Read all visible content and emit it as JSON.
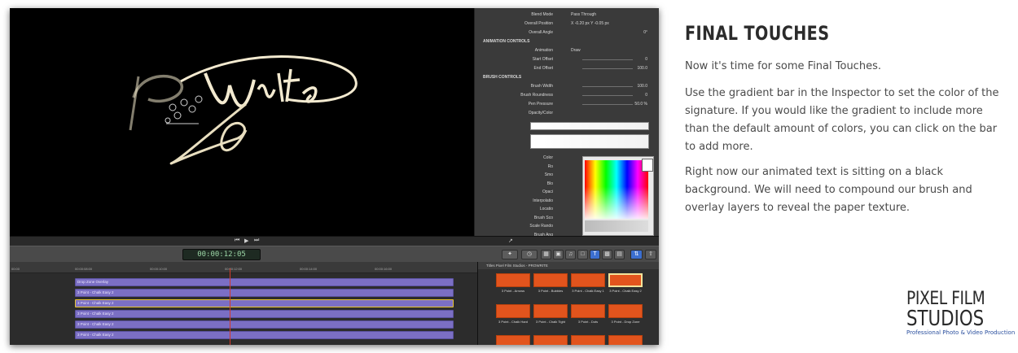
{
  "article": {
    "heading": "FINAL TOUCHES",
    "paragraphs": [
      "Now it's time for some Final Touches.",
      "Use the gradient bar in the Inspector to set the color of the signature. If you would like the gradient to include more than the default amount of colors, you can click on the bar to add more.",
      "Right now our animated text is sitting on a black background. We will need to compound our brush and overlay layers to reveal the paper texture."
    ]
  },
  "logo": {
    "line1": "PIXEL FILM",
    "line2": "STUDIOS",
    "tagline": "Professional Photo & Video Production"
  },
  "viewer": {
    "signature_text": "ProWrite"
  },
  "inspector": {
    "rows": [
      {
        "label": "Blend Mode",
        "value": "Pass Through",
        "num": ""
      },
      {
        "label": "Overall Position",
        "value": "X  -0.20 px   Y  -0.05 px",
        "num": ""
      },
      {
        "label": "Overall Angle",
        "value": "",
        "num": "0°"
      },
      {
        "label": "ANIMATION CONTROLS",
        "value": "",
        "num": ""
      },
      {
        "label": "Animation",
        "value": "Draw",
        "num": ""
      },
      {
        "label": "Start Offset",
        "value": "",
        "num": "0"
      },
      {
        "label": "End Offset",
        "value": "",
        "num": "100.0"
      },
      {
        "label": "BRUSH CONTROLS",
        "value": "",
        "num": ""
      },
      {
        "label": "Brush Width",
        "value": "",
        "num": "100.0"
      },
      {
        "label": "Brush Roundness",
        "value": "",
        "num": "0"
      },
      {
        "label": "Pen Pressure",
        "value": "",
        "num": "50.0 %"
      },
      {
        "label": "Opacity/Color",
        "value": "",
        "num": ""
      }
    ],
    "lower_labels": [
      "Color",
      "Ro",
      "Smo",
      "Blo",
      "Opaci",
      "Interpolatio",
      "Locatio",
      "Brush Sco",
      "Scale Rando",
      "Brush Ang"
    ]
  },
  "toolbar": {
    "timecode": "00:00:12:05"
  },
  "timeline": {
    "ruler_ticks": [
      "00:00",
      "00:00:08:00",
      "00:00:10:00",
      "00:00:12:00",
      "00:00:14:00",
      "00:00:16:00"
    ],
    "clips": [
      "Drop Zone Overlay",
      "3 Point - Chalk Easy 2",
      "3 Point - Chalk Easy 2",
      "3 Point - Chalk Easy 2",
      "3 Point - Chalk Easy 2",
      "3 Point - Chalk Easy 2"
    ]
  },
  "browser": {
    "header": "Titles   Pixel Film Studios - PROWRITE",
    "thumbs": [
      "3 Point - Arrows",
      "3 Point - Bubbles",
      "3 Point - Chalk Easy 1",
      "3 Point - Chalk Easy 2",
      "3 Point - Chalk Hard",
      "3 Point - Chalk Tight",
      "3 Point - Dots",
      "3 Point - Drop Zone"
    ]
  }
}
